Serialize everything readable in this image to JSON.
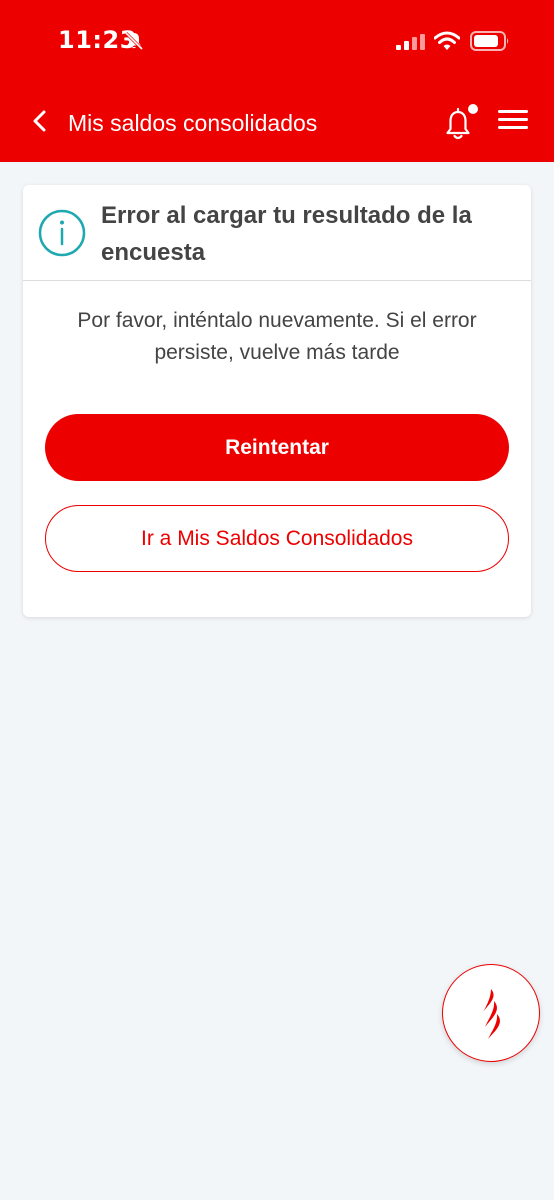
{
  "status_bar": {
    "time": "11:23",
    "icons": [
      "bell-off-icon",
      "signal-icon",
      "wifi-icon",
      "battery-icon"
    ]
  },
  "nav": {
    "title": "Mis saldos consolidados",
    "back_icon": "chevron-left-icon",
    "notifications_icon": "bell-icon",
    "menu_icon": "hamburger-menu-icon"
  },
  "card": {
    "icon": "info-icon",
    "title": "Error al cargar tu resultado de la encuesta",
    "message": "Por favor, inténtalo nuevamente. Si el error persiste, vuelve más tarde",
    "primary_button": "Reintentar",
    "secondary_button": "Ir a Mis Saldos Consolidados"
  },
  "fab": {
    "icon": "santander-flame-icon"
  },
  "colors": {
    "brand_red": "#ec0000",
    "background": "#f3f6f9",
    "info_teal": "#1fa8b0",
    "text": "#444444"
  }
}
